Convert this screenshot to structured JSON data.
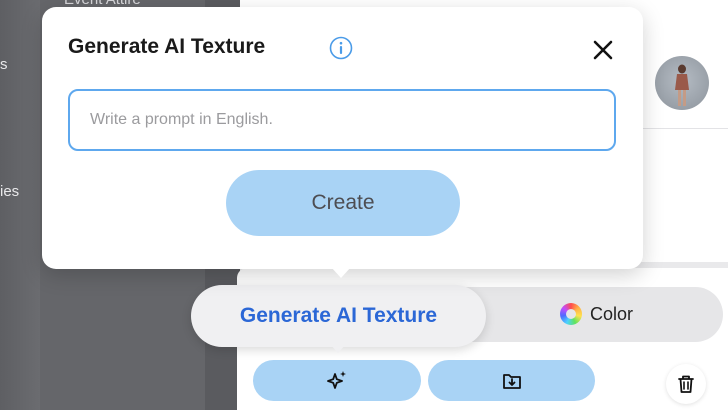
{
  "background": {
    "rail_items": [
      "s",
      "ies"
    ],
    "section_label": "Event Attire"
  },
  "dialog": {
    "title": "Generate AI Texture",
    "prompt": {
      "value": "",
      "placeholder": "Write a prompt in English."
    },
    "create_label": "Create"
  },
  "mode_toggle": {
    "active_label": "Generate AI Texture",
    "color_label": "Color"
  },
  "colors": {
    "accent_blue": "#2b67d6",
    "button_blue": "#a9d3f5",
    "input_border": "#5ea8ee"
  },
  "icons": {
    "info": "info-icon",
    "close": "close-icon",
    "sparkle": "sparkle-icon",
    "import": "import-icon",
    "trash": "trash-icon"
  }
}
